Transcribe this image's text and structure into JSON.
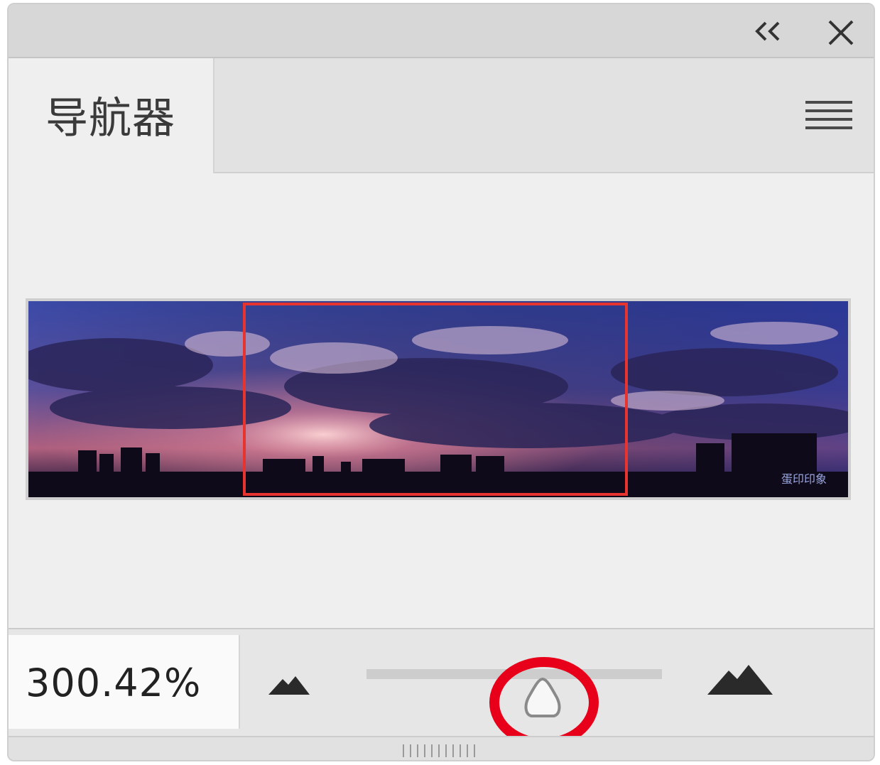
{
  "window": {
    "collapse_icon": "double-chevron-left-icon",
    "close_icon": "close-icon"
  },
  "tab": {
    "label": "导航器",
    "menu_icon": "hamburger-menu-icon"
  },
  "navigator": {
    "thumbnail_watermark": "蛋印印象",
    "view_box_color": "#e8342e"
  },
  "zoom": {
    "value": "300.42%",
    "zoom_out_icon": "small-mountain-icon",
    "zoom_in_icon": "large-mountain-icon",
    "slider_position": 0.6
  },
  "annotation": {
    "highlight_color": "#e8001a"
  },
  "colors": {
    "panel_bg": "#efefef",
    "titlebar_bg": "#d7d7d7",
    "track": "#cdcdcd"
  }
}
